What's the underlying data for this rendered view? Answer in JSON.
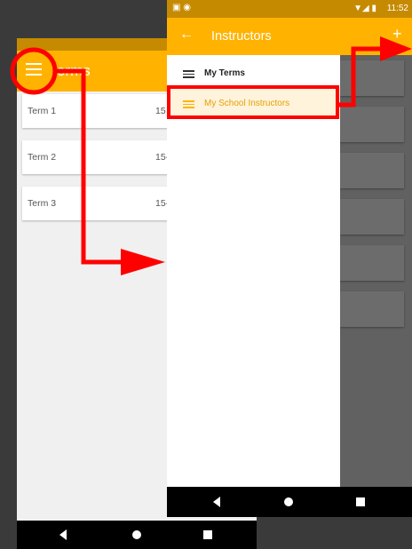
{
  "back_screen": {
    "title_visible": "erms",
    "terms": [
      {
        "name": "Term 1",
        "date": "15"
      },
      {
        "name": "Term 2",
        "date": "15-"
      },
      {
        "name": "Term 3",
        "date": "15-"
      }
    ]
  },
  "front_screen": {
    "status_time": "11:52",
    "title": "Instructors",
    "drawer_items": [
      {
        "label": "My Terms",
        "active": false
      },
      {
        "label": "My School Instructors",
        "active": true
      }
    ]
  },
  "colors": {
    "accent": "#ffb300",
    "status_bar": "#c68a00",
    "annotation": "#ff0000",
    "active_highlight": "#fff3dc"
  },
  "icons": [
    "menu-icon",
    "back-arrow-icon",
    "plus-icon",
    "list-icon",
    "back-nav-icon",
    "home-nav-icon",
    "recents-nav-icon"
  ]
}
